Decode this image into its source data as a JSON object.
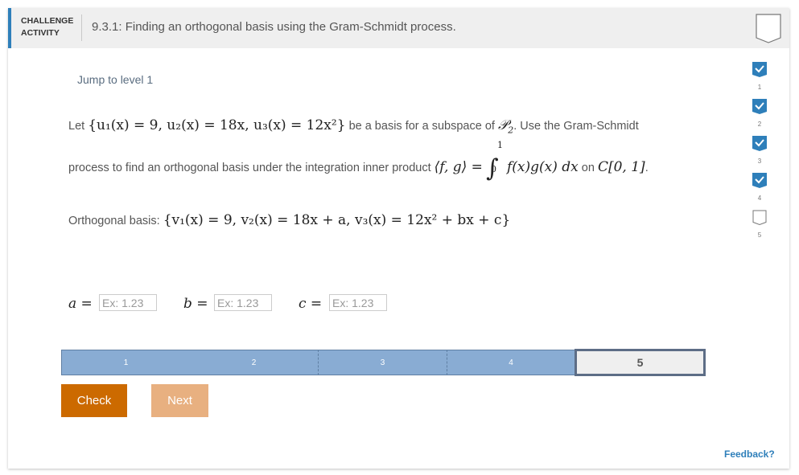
{
  "header": {
    "label_line1": "CHALLENGE",
    "label_line2": "ACTIVITY",
    "title": "9.3.1: Finding an orthogonal basis using the Gram-Schmidt process.",
    "badge_icon": "completion-badge-icon",
    "accent_color": "#2e7fba"
  },
  "jump_link": "Jump to level 1",
  "problem": {
    "line1_prefix": "Let",
    "basis_u": "{u₁(x) = 9, u₂(x) = 18x, u₃(x) = 12x²}",
    "line1_mid": "be a basis for a subspace of",
    "space": "𝒫",
    "space_sub": "2",
    "line1_suffix": ". Use the Gram-Schmidt",
    "line2_prefix": "process to find an orthogonal basis under the integration inner product",
    "inner_product": "⟨f, g⟩ =",
    "integral_upper": "1",
    "integral_lower": "0",
    "integrand": "f(x)g(x) dx",
    "line2_on": "on",
    "interval": "C[0, 1]",
    "line2_end": "."
  },
  "orthogonal": {
    "label": "Orthogonal basis:",
    "expression": "{v₁(x) = 9, v₂(x) = 18x + a, v₃(x) = 12x² + bx + c}"
  },
  "inputs": [
    {
      "label": "a =",
      "placeholder": "Ex: 1.23",
      "value": ""
    },
    {
      "label": "b =",
      "placeholder": "Ex: 1.23",
      "value": ""
    },
    {
      "label": "c =",
      "placeholder": "Ex: 1.23",
      "value": ""
    }
  ],
  "levels": [
    {
      "label": "1",
      "status": "completed"
    },
    {
      "label": "2",
      "status": "completed"
    },
    {
      "label": "3",
      "status": "completed"
    },
    {
      "label": "4",
      "status": "completed"
    },
    {
      "label": "5",
      "status": "current"
    }
  ],
  "buttons": {
    "check": "Check",
    "next": "Next"
  },
  "sidebar_levels": [
    {
      "num": "1",
      "completed": true
    },
    {
      "num": "2",
      "completed": true
    },
    {
      "num": "3",
      "completed": true
    },
    {
      "num": "4",
      "completed": true
    },
    {
      "num": "5",
      "completed": false
    }
  ],
  "feedback": "Feedback?",
  "colors": {
    "level_complete": "#89acd3",
    "check_button": "#cc6a00",
    "next_button": "#e8b080",
    "badge_complete": "#2e7fba"
  }
}
